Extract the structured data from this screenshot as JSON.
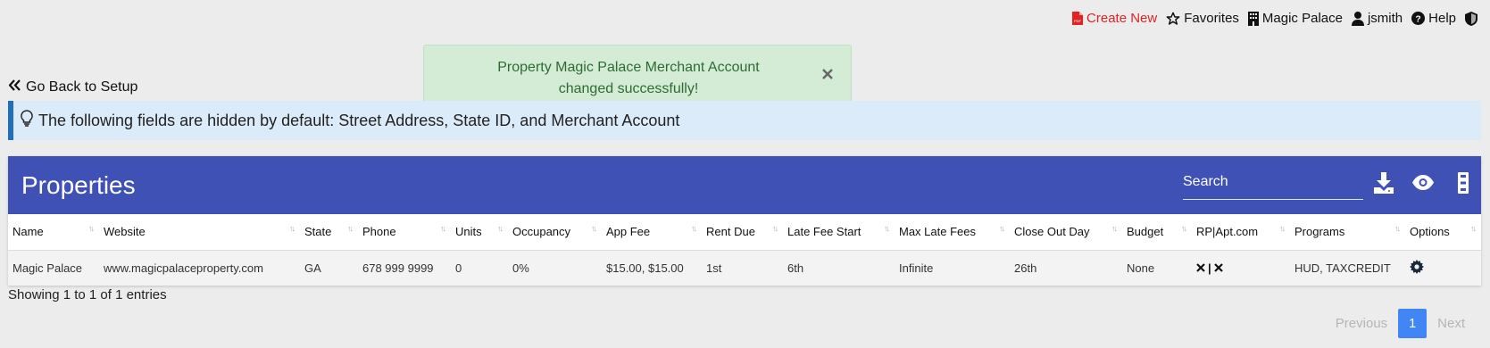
{
  "topnav": {
    "create_new": "Create New",
    "favorites": "Favorites",
    "property": "Magic Palace",
    "user": "jsmith",
    "help": "Help"
  },
  "toast": {
    "message": "Property Magic Palace Merchant Account changed successfully!"
  },
  "goback": {
    "label": "Go Back to Setup"
  },
  "info": {
    "text": "The following fields are hidden by default: Street Address, State ID, and Merchant Account"
  },
  "card": {
    "title": "Properties",
    "search_placeholder": "Search"
  },
  "table": {
    "headers": [
      "Name",
      "Website",
      "State",
      "Phone",
      "Units",
      "Occupancy",
      "App Fee",
      "Rent Due",
      "Late Fee Start",
      "Max Late Fees",
      "Close Out Day",
      "Budget",
      "RP|Apt.com",
      "Programs",
      "Options"
    ],
    "row": {
      "name": "Magic Palace",
      "website": "www.magicpalaceproperty.com",
      "state": "GA",
      "phone": "678 999 9999",
      "units": "0",
      "occupancy": "0%",
      "app_fee": "$15.00, $15.00",
      "rent_due": "1st",
      "late_fee_start": "6th",
      "max_late_fees": "Infinite",
      "close_out_day": "26th",
      "budget": "None",
      "rp_separator": "|",
      "programs": "HUD, TAXCREDIT"
    }
  },
  "footer": {
    "showing": "Showing 1 to 1 of 1 entries",
    "previous": "Previous",
    "page": "1",
    "next": "Next"
  },
  "colors": {
    "header_blue": "#3f51b5",
    "accent_red": "#e02424",
    "success_green": "#2e6b33",
    "page_blue": "#4285f4"
  },
  "icons": [
    "pdf-icon",
    "star-icon",
    "building-icon",
    "user-icon",
    "question-circle-icon",
    "shield-icon",
    "close-icon",
    "double-chevron-left-icon",
    "lightbulb-icon",
    "download-icon",
    "eye-icon",
    "columns-icon",
    "x-icon",
    "gear-icon"
  ]
}
